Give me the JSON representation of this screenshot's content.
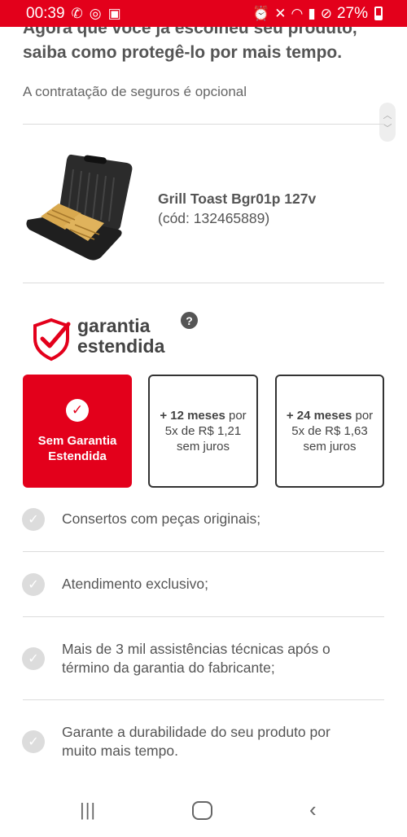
{
  "status_bar": {
    "time": "00:39",
    "left_icons": [
      "whatsapp-icon",
      "instagram-icon",
      "gallery-icon"
    ],
    "right_icons": [
      "alarm-icon",
      "mute-icon",
      "wifi-icon",
      "signal-icon",
      "no-disturb-icon"
    ],
    "battery": "27%"
  },
  "heading": {
    "line1": "Agora que você já escolheu seu produto,",
    "line2": "saiba como protegê-lo por mais tempo."
  },
  "optional_text": "A contratação de seguros é opcional",
  "product": {
    "name": "Grill Toast Bgr01p 127v",
    "code": "(cód: 132465889)"
  },
  "garantia": {
    "title_line1": "garantia",
    "title_line2": "estendida",
    "help": "?"
  },
  "options": {
    "none": {
      "line1": "Sem Garantia",
      "line2": "Estendida"
    },
    "plan12": {
      "months": "+ 12 meses",
      "suffix": " por",
      "line2": "5x de R$ 1,21",
      "line3": "sem juros"
    },
    "plan24": {
      "months": "+ 24 meses",
      "suffix": " por",
      "line2": "5x de R$ 1,63",
      "line3": "sem juros"
    }
  },
  "benefits": [
    "Consertos com peças originais;",
    "Atendimento exclusivo;",
    "Mais de 3 mil assistências técnicas após o término da garantia do fabricante;",
    "Garante a durabilidade do seu produto por muito mais tempo."
  ],
  "colors": {
    "accent": "#e3001b",
    "text": "#555555",
    "divider": "#dcdcdc"
  }
}
